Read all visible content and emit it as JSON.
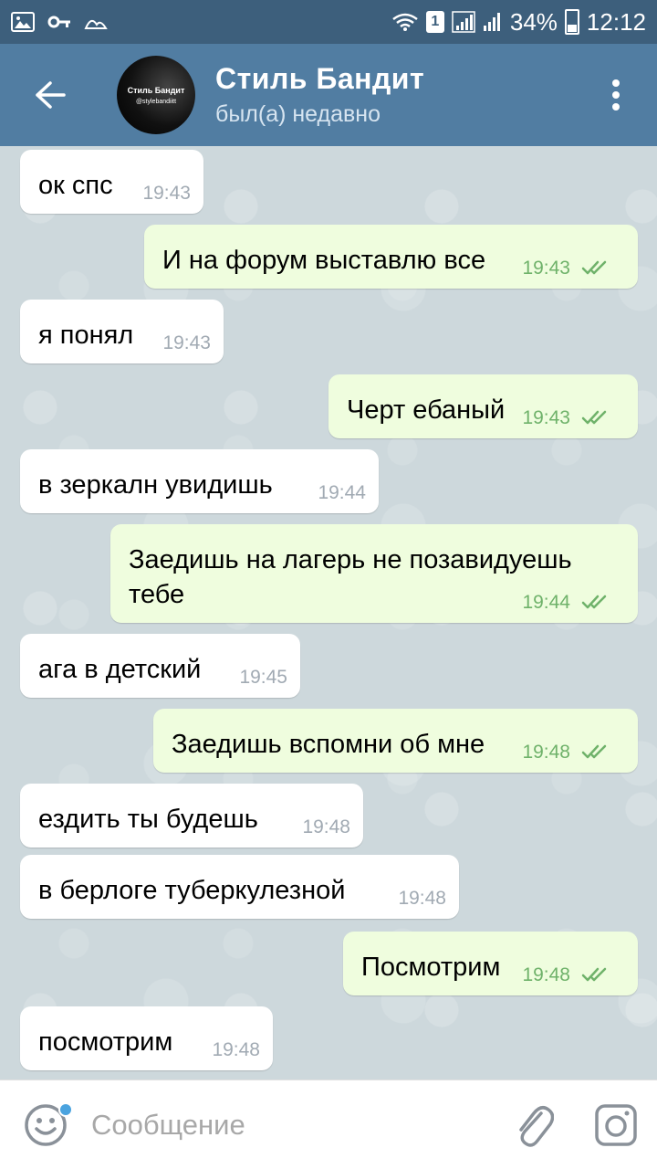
{
  "status_bar": {
    "badge": "1",
    "battery": "34%",
    "time": "12:12",
    "icons": [
      "image-icon",
      "key-icon",
      "notification-icon",
      "wifi-icon",
      "signal-icon",
      "battery-icon"
    ]
  },
  "header": {
    "title": "Стиль Бандит",
    "status": "был(а) недавно",
    "avatar_line1": "Стиль Бандит",
    "avatar_line2": "@stylebandiitt"
  },
  "messages": [
    {
      "dir": "in",
      "text": "ок спс",
      "time": "19:43"
    },
    {
      "dir": "out",
      "text": "И на форум выставлю все",
      "time": "19:43"
    },
    {
      "dir": "in",
      "text": "я понял",
      "time": "19:43"
    },
    {
      "dir": "out",
      "text": "Черт ебаный",
      "time": "19:43"
    },
    {
      "dir": "in",
      "text": "в зеркалн увидишь",
      "time": "19:44"
    },
    {
      "dir": "out",
      "text": "Заедишь на лагерь не позавидуешь\nтебе",
      "time": "19:44"
    },
    {
      "dir": "in",
      "text": "ага в детский",
      "time": "19:45"
    },
    {
      "dir": "out",
      "text": "Заедишь вспомни об мне",
      "time": "19:48"
    },
    {
      "dir": "in",
      "text": "ездить ты будешь",
      "time": "19:48"
    },
    {
      "dir": "in",
      "text": "в берлоге туберкулезной",
      "time": "19:48"
    },
    {
      "dir": "out",
      "text": "Посмотрим",
      "time": "19:48"
    },
    {
      "dir": "in",
      "text": "посмотрим",
      "time": "19:48"
    }
  ],
  "composer": {
    "placeholder": "Сообщение"
  },
  "colors": {
    "header_bg": "#517da2",
    "statusbar_bg": "#3d5f7c",
    "incoming_bubble": "#ffffff",
    "outgoing_bubble": "#effdde",
    "read_ticks": "#6fb26a"
  }
}
